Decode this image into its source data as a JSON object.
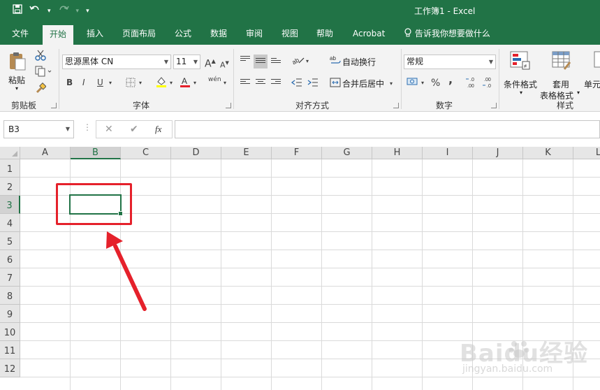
{
  "app": {
    "title": "工作簿1 - Excel"
  },
  "qat": {
    "save_icon": "save-icon",
    "undo_icon": "undo-icon",
    "redo_icon": "redo-icon",
    "customize_icon": "chevron-down-icon"
  },
  "tabs": [
    {
      "label": "文件"
    },
    {
      "label": "开始"
    },
    {
      "label": "插入"
    },
    {
      "label": "页面布局"
    },
    {
      "label": "公式"
    },
    {
      "label": "数据"
    },
    {
      "label": "审阅"
    },
    {
      "label": "视图"
    },
    {
      "label": "帮助"
    },
    {
      "label": "Acrobat"
    }
  ],
  "tell_me": "告诉我你想要做什么",
  "ribbon": {
    "clipboard": {
      "label": "剪贴板",
      "paste": "粘贴"
    },
    "font": {
      "label": "字体",
      "name": "思源黑体 CN",
      "size": "11",
      "bold": "B",
      "italic": "I",
      "underline": "U",
      "grow": "A",
      "shrink": "A",
      "phonetic": "wén"
    },
    "alignment": {
      "label": "对齐方式",
      "wrap": "自动换行",
      "merge": "合并后居中"
    },
    "number": {
      "label": "数字",
      "format": "常规",
      "percent": "%",
      "comma": ","
    },
    "styles": {
      "label": "样式",
      "conditional": "条件格式",
      "table_format_1": "套用",
      "table_format_2": "表格格式",
      "cell_styles": "单元"
    }
  },
  "formula_bar": {
    "name_box": "B3",
    "cancel": "✕",
    "enter": "✔",
    "fx": "fx",
    "value": ""
  },
  "sheet": {
    "columns": [
      "A",
      "B",
      "C",
      "D",
      "E",
      "F",
      "G",
      "H",
      "I",
      "J",
      "K",
      "L"
    ],
    "rows": [
      "1",
      "2",
      "3",
      "4",
      "5",
      "6",
      "7",
      "8",
      "9",
      "10",
      "11",
      "12"
    ],
    "active_cell": "B3",
    "selected_column": "B",
    "selected_row": "3"
  },
  "watermark": {
    "brand": "Baidu经验",
    "url": "jingyan.baidu.com"
  },
  "colors": {
    "accent": "#217346",
    "annotation": "#e5212b"
  }
}
